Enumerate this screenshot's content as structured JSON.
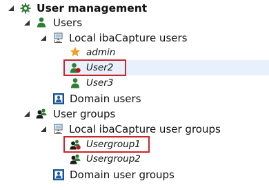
{
  "tree": {
    "root": {
      "label": "User management",
      "icon": "gear-icon"
    },
    "users": {
      "label": "Users",
      "icon": "user-icon",
      "local": {
        "label": "Local ibaCapture users",
        "icon": "local-computer-icon",
        "items": [
          {
            "label": "admin",
            "icon": "star-icon"
          },
          {
            "label": "User2",
            "icon": "user-edit-icon",
            "selected": true
          },
          {
            "label": "User3",
            "icon": "user-icon"
          }
        ]
      },
      "domain": {
        "label": "Domain users",
        "icon": "domain-user-icon"
      }
    },
    "groups": {
      "label": "User groups",
      "icon": "user-group-icon",
      "local": {
        "label": "Local ibaCapture user groups",
        "icon": "local-computer-icon",
        "items": [
          {
            "label": "Usergroup1",
            "icon": "user-group-edit-icon",
            "highlighted": true
          },
          {
            "label": "Usergroup2",
            "icon": "user-group-icon"
          }
        ]
      },
      "domain": {
        "label": "Domain user groups",
        "icon": "domain-user-icon"
      }
    }
  },
  "colors": {
    "user_green": "#2e7d32",
    "edit_red": "#b71c1c",
    "star_orange": "#f0a020",
    "domain_blue": "#1f5fa8",
    "selection": "#e8f1fb",
    "highlight_border": "#c8252c"
  }
}
